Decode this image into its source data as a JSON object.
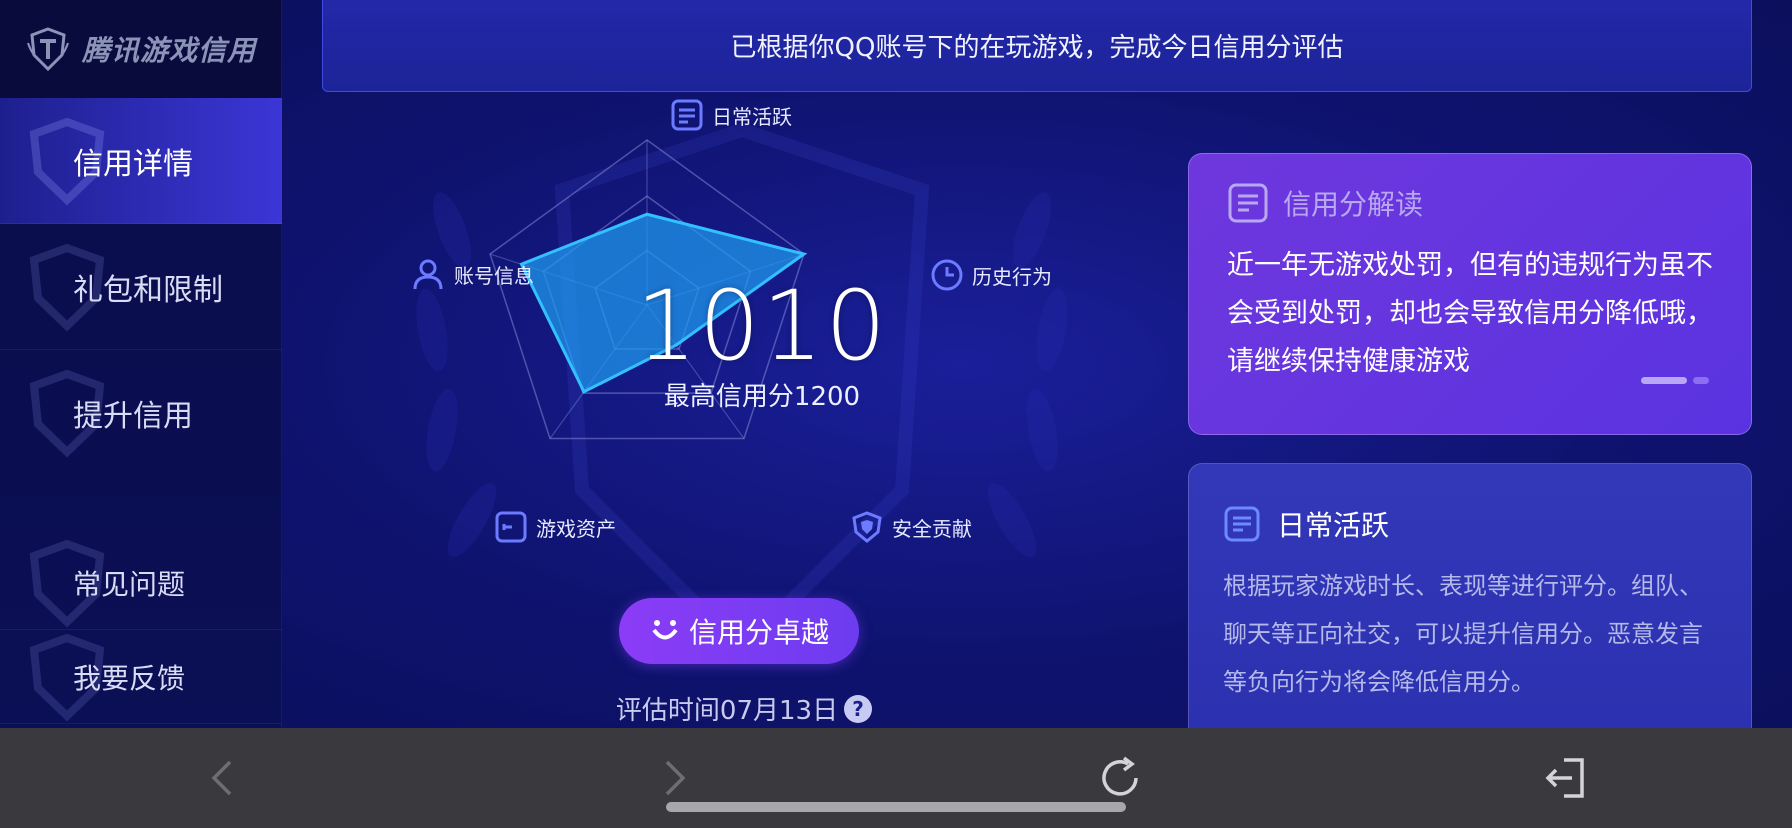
{
  "app": {
    "brand": "腾讯游戏信用"
  },
  "sidebar": {
    "items": [
      {
        "label": "信用详情",
        "active": true
      },
      {
        "label": "礼包和限制",
        "active": false
      },
      {
        "label": "提升信用",
        "active": false
      },
      {
        "label": "常见问题",
        "active": false
      },
      {
        "label": "我要反馈",
        "active": false
      }
    ]
  },
  "banner": {
    "text": "已根据你QQ账号下的在玩游戏，完成今日信用分评估"
  },
  "radar": {
    "axes": [
      {
        "label": "日常活跃",
        "value": 0.55,
        "icon": "document-icon"
      },
      {
        "label": "历史行为",
        "value": 1.0,
        "icon": "clock-icon"
      },
      {
        "label": "安全贡献",
        "value": 0.3,
        "icon": "shield-icon"
      },
      {
        "label": "游戏资产",
        "value": 0.65,
        "icon": "card-icon"
      },
      {
        "label": "账号信息",
        "value": 0.8,
        "icon": "user-icon"
      }
    ]
  },
  "score": {
    "value": "1010",
    "max_label": "最高信用分1200",
    "level": "信用分卓越",
    "eval_time": "评估时间07月13日",
    "help": "?"
  },
  "interpret_card": {
    "title": "信用分解读",
    "body": "近一年无游戏处罚，但有的违规行为虽不会受到处罚，却也会导致信用分降低哦，请继续保持健康游戏"
  },
  "daily_card": {
    "title": "日常活跃",
    "body": "根据玩家游戏时长、表现等进行评分。组队、聊天等正向社交，可以提升信用分。恶意发言等负向行为将会降低信用分。"
  },
  "colors": {
    "accent": "#6d3cf0",
    "radar_fill": "#1e9bf0",
    "background": "#0c0f5e"
  }
}
